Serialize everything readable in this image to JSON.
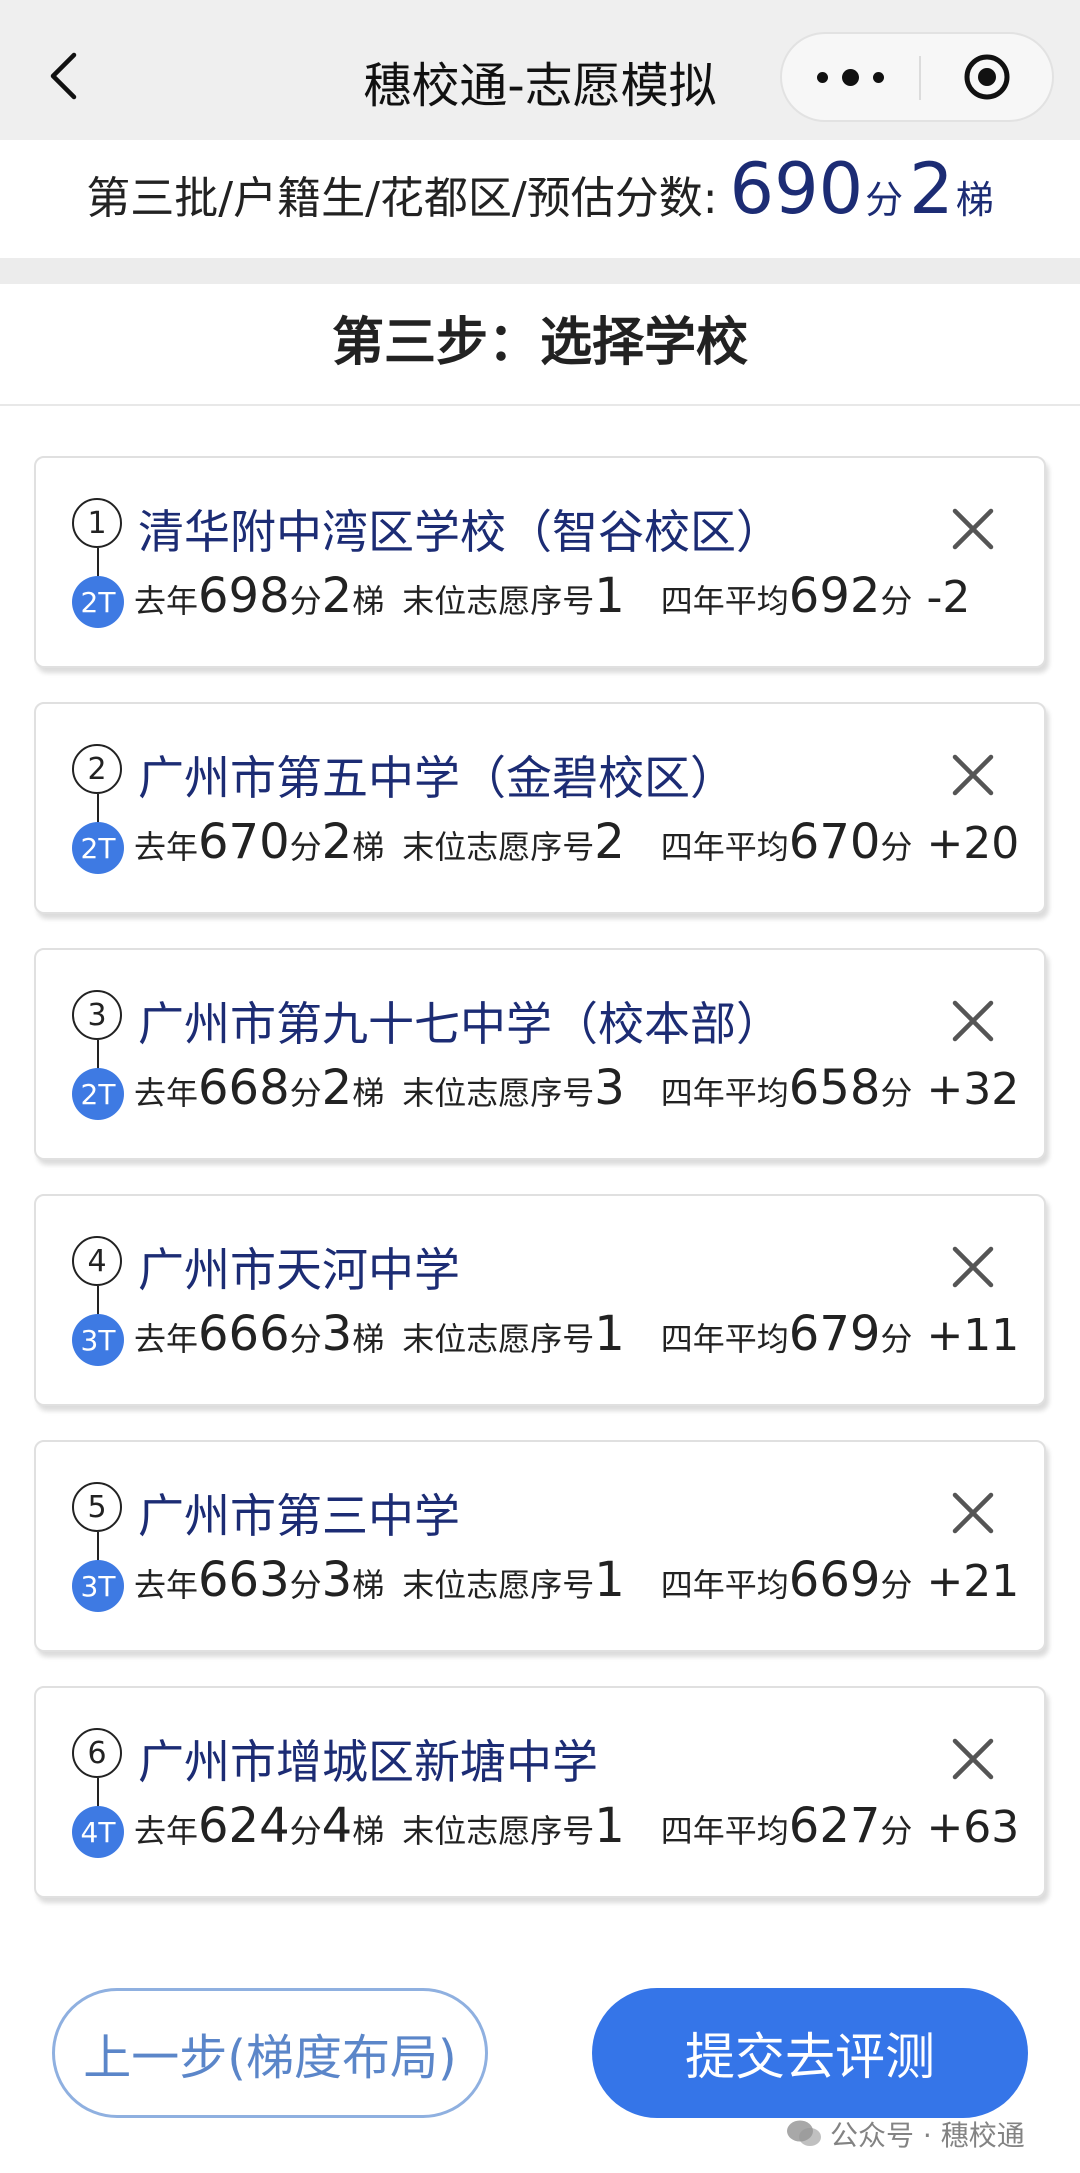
{
  "navbar": {
    "title": "穗校通-志愿模拟",
    "back_icon": "chevron-left-icon",
    "more_icon": "more-dots-icon",
    "close_icon": "target-circle-icon"
  },
  "score_bar": {
    "label": "第三批/户籍生/花都区/预估分数:",
    "score": "690",
    "score_unit": "分",
    "tier": "2",
    "tier_unit": "梯"
  },
  "step": {
    "title": "第三步：选择学校"
  },
  "labels": {
    "last_year": "去年",
    "score_unit": "分",
    "tier_unit": "梯",
    "last_rank": "末位志愿序号",
    "four_year_avg": "四年平均"
  },
  "schools": [
    {
      "rank": "1",
      "tier_badge": "2T",
      "name": "清华附中湾区学校（智谷校区）",
      "last_score": "698",
      "last_tier": "2",
      "last_choice": "1",
      "avg_score": "692",
      "diff": "-2"
    },
    {
      "rank": "2",
      "tier_badge": "2T",
      "name": "广州市第五中学（金碧校区）",
      "last_score": "670",
      "last_tier": "2",
      "last_choice": "2",
      "avg_score": "670",
      "diff": "+20"
    },
    {
      "rank": "3",
      "tier_badge": "2T",
      "name": "广州市第九十七中学（校本部）",
      "last_score": "668",
      "last_tier": "2",
      "last_choice": "3",
      "avg_score": "658",
      "diff": "+32"
    },
    {
      "rank": "4",
      "tier_badge": "3T",
      "name": "广州市天河中学",
      "last_score": "666",
      "last_tier": "3",
      "last_choice": "1",
      "avg_score": "679",
      "diff": "+11"
    },
    {
      "rank": "5",
      "tier_badge": "3T",
      "name": "广州市第三中学",
      "last_score": "663",
      "last_tier": "3",
      "last_choice": "1",
      "avg_score": "669",
      "diff": "+21"
    },
    {
      "rank": "6",
      "tier_badge": "4T",
      "name": "广州市增城区新塘中学",
      "last_score": "624",
      "last_tier": "4",
      "last_choice": "1",
      "avg_score": "627",
      "diff": "+63"
    }
  ],
  "buttons": {
    "prev": "上一步(梯度布局)",
    "submit": "提交去评测"
  },
  "watermark": {
    "icon": "wechat-icon",
    "text": "公众号 · 穗校通"
  },
  "colors": {
    "accent_blue": "#3575e8",
    "tier_badge_blue": "#3e7ae3",
    "school_name_navy": "#1c2c74",
    "prev_button_border": "#8fb0e0"
  }
}
